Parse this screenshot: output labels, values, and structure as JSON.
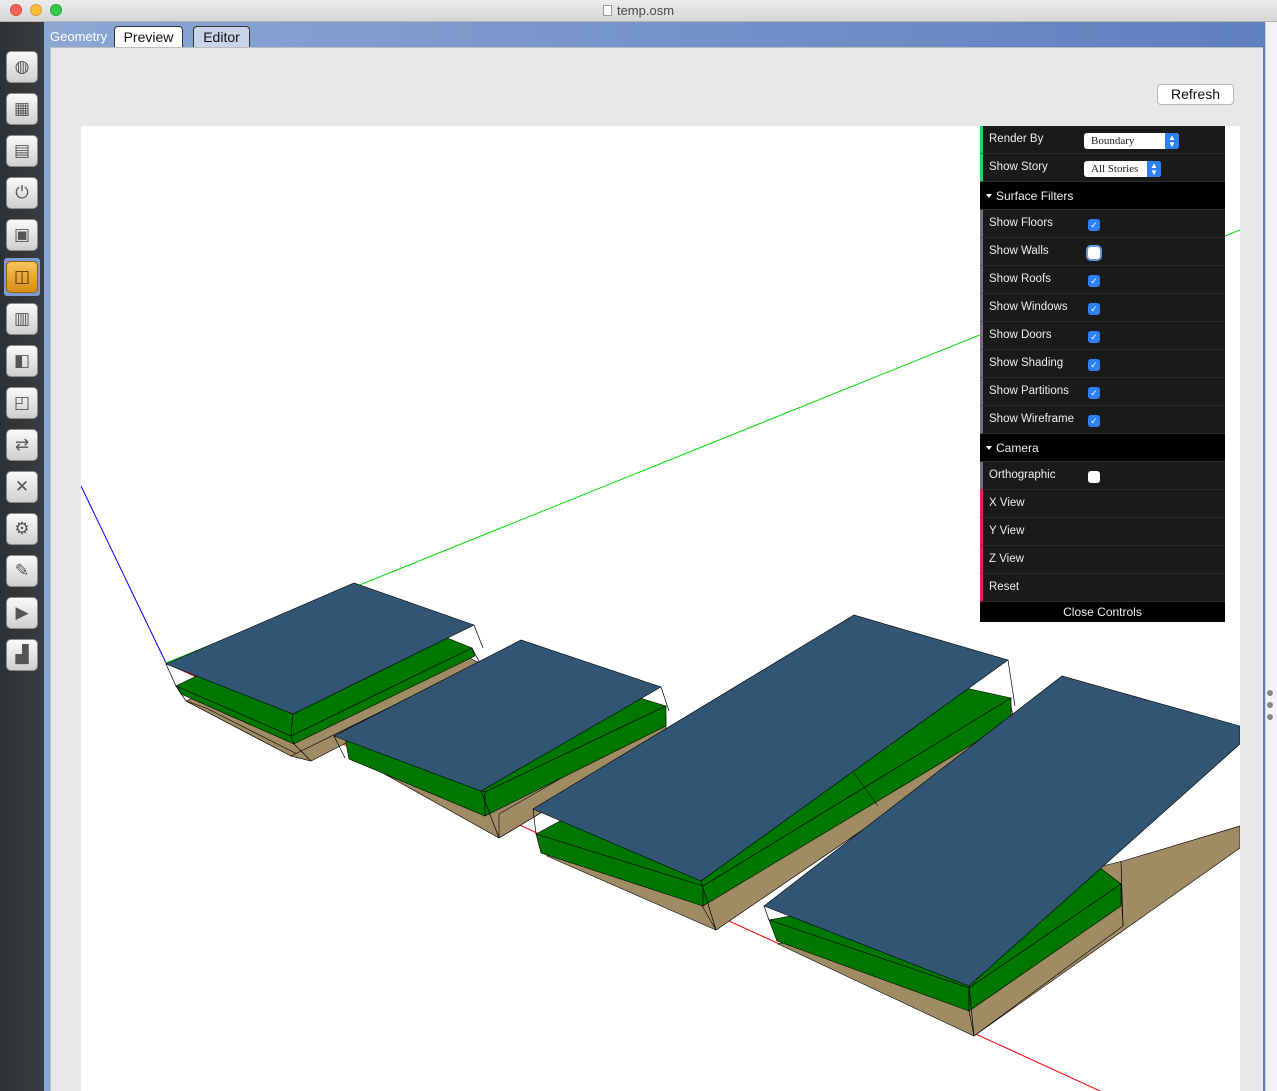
{
  "window": {
    "title": "temp.osm"
  },
  "tabs": {
    "section_title": "Geometry",
    "preview_label": "Preview",
    "editor_label": "Editor"
  },
  "toolbar": {
    "refresh_label": "Refresh"
  },
  "sidebar": {
    "items": [
      {
        "icon": "site-globe-icon",
        "glyph": "◍"
      },
      {
        "icon": "schedules-calendar-icon",
        "glyph": "▦"
      },
      {
        "icon": "constructions-brick-icon",
        "glyph": "▤"
      },
      {
        "icon": "loads-outlet-icon",
        "glyph": "⏻"
      },
      {
        "icon": "space-types-icon",
        "glyph": "▣"
      },
      {
        "icon": "geometry-icon",
        "glyph": "◫"
      },
      {
        "icon": "facility-building-icon",
        "glyph": "▥"
      },
      {
        "icon": "spaces-box-icon",
        "glyph": "◧"
      },
      {
        "icon": "thermal-zones-icon",
        "glyph": "◰"
      },
      {
        "icon": "hvac-systems-icon",
        "glyph": "⇄"
      },
      {
        "icon": "variables-icon",
        "glyph": "✕"
      },
      {
        "icon": "simulation-settings-gear-icon",
        "glyph": "⚙"
      },
      {
        "icon": "measures-scroll-icon",
        "glyph": "✎"
      },
      {
        "icon": "run-simulation-icon",
        "glyph": "▶"
      },
      {
        "icon": "results-chart-icon",
        "glyph": "▟"
      }
    ],
    "active_index": 5
  },
  "controls": {
    "render_by_label": "Render By",
    "render_by_value": "Boundary",
    "show_story_label": "Show Story",
    "show_story_value": "All Stories",
    "surface_filters_label": "Surface Filters",
    "show_floors_label": "Show Floors",
    "show_floors": true,
    "show_walls_label": "Show Walls",
    "show_walls": false,
    "show_roofs_label": "Show Roofs",
    "show_roofs": true,
    "show_windows_label": "Show Windows",
    "show_windows": true,
    "show_doors_label": "Show Doors",
    "show_doors": true,
    "show_shading_label": "Show Shading",
    "show_shading": true,
    "show_partitions_label": "Show Partitions",
    "show_partitions": true,
    "show_wireframe_label": "Show Wireframe",
    "show_wireframe": true,
    "camera_label": "Camera",
    "orthographic_label": "Orthographic",
    "orthographic": false,
    "x_view_label": "X View",
    "y_view_label": "Y View",
    "z_view_label": "Z View",
    "reset_label": "Reset",
    "close_controls_label": "Close Controls"
  },
  "scene": {
    "colors": {
      "roof": "#325574",
      "floor_mid": "#007800",
      "ground": "#a08c64",
      "axis_x": "#ff0000",
      "axis_y": "#00dd00",
      "axis_z": "#0000ff"
    }
  }
}
